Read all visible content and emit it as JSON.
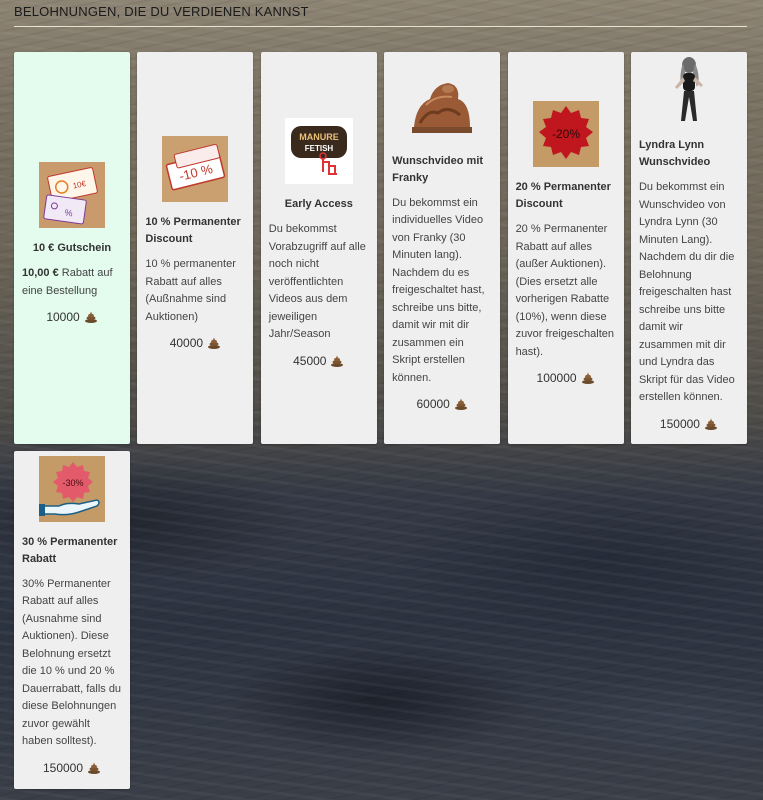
{
  "header": {
    "title": "Belohnungen, die du verdienen kannst"
  },
  "rewards": [
    {
      "name": "10 € Gutschein",
      "desc_bold": "10,00 €",
      "desc": " Rabatt auf eine Bestellung",
      "cost": "10000",
      "icon": "voucher-icon"
    },
    {
      "name": "10 % Permanenter Discount",
      "desc": "10 % permanenter Rabatt auf alles (Außnahme sind Auktionen)",
      "cost": "40000",
      "icon": "ticket-10-percent-icon",
      "badge": "-10 %"
    },
    {
      "name": "Early Access",
      "desc": "Du bekommst Vorabzugriff auf alle noch nicht veröffentlichten Videos aus dem jeweiligen Jahr/Season",
      "cost": "45000",
      "icon": "manure-fetish-badge-icon",
      "badge_line1": "MANURE",
      "badge_line2": "FETISH"
    },
    {
      "name": "Wunschvideo mit Franky",
      "desc": "Du bekommst ein individuelles Video von Franky (30 Minuten lang). Nachdem du es freigeschaltet hast, schreibe uns bitte, damit wir mit dir zusammen ein Skript erstellen können.",
      "cost": "60000",
      "icon": "mud-sculpture-icon"
    },
    {
      "name": "20 % Permanenter Discount",
      "desc": "20 % Permanenter Rabatt auf alles (außer Auktionen). (Dies ersetzt alle vorherigen Rabatte (10%), wenn diese zuvor freigeschalten hast).",
      "cost": "100000",
      "icon": "seal-20-percent-icon",
      "badge": "-20%"
    },
    {
      "name": "Lyndra Lynn Wunschvideo",
      "desc": "Du bekommst ein Wunschvideo von Lyndra Lynn (30 Minuten Lang). Nachdem du dir die Belohnung freigeschalten hast schreibe uns bitte damit wir zusammen mit dir und Lyndra das Skript für das Video erstellen können.",
      "cost": "150000",
      "icon": "person-photo-icon"
    },
    {
      "name": "30 % Permanenter Rabatt",
      "desc": "30% Permanenter Rabatt auf alles (Ausnahme sind Auktionen). Diese Belohnung ersetzt die 10 % und 20 % Dauerrabatt, falls du diese Belohnungen zuvor gewählt haben solltest).",
      "cost": "150000",
      "icon": "hand-30-percent-icon",
      "badge": "-30%"
    }
  ],
  "currency_icon": "poop-coin-icon"
}
